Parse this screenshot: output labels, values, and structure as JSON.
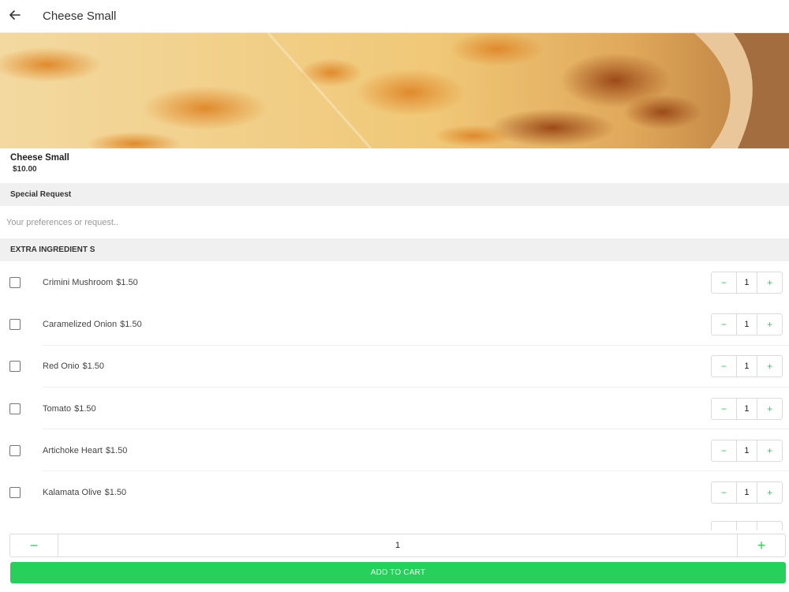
{
  "header": {
    "title": "Cheese Small",
    "back_icon": "arrow-left-icon"
  },
  "product": {
    "name": "Cheese Small",
    "price": "$10.00",
    "image": "cheese-pizza-photo"
  },
  "special_request": {
    "heading": "Special Request",
    "placeholder": "Your preferences or request..",
    "value": ""
  },
  "extras": {
    "heading": "EXTRA INGREDIENT S",
    "items": [
      {
        "name": "Crimini Mushroom",
        "price": "$1.50",
        "qty": "1",
        "checked": false
      },
      {
        "name": "Caramelized Onion",
        "price": "$1.50",
        "qty": "1",
        "checked": false
      },
      {
        "name": "Red Onio",
        "price": "$1.50",
        "qty": "1",
        "checked": false
      },
      {
        "name": "Tomato",
        "price": "$1.50",
        "qty": "1",
        "checked": false
      },
      {
        "name": "Artichoke Heart",
        "price": "$1.50",
        "qty": "1",
        "checked": false
      },
      {
        "name": "Kalamata Olive",
        "price": "$1.50",
        "qty": "1",
        "checked": false
      }
    ],
    "decrement_symbol": "−",
    "increment_symbol": "+"
  },
  "footer": {
    "quantity": "1",
    "decrement_symbol": "−",
    "increment_symbol": "+",
    "add_to_cart_label": "ADD TO CART"
  },
  "colors": {
    "accent": "#27d05a",
    "section_bg": "#f0f0f0"
  }
}
